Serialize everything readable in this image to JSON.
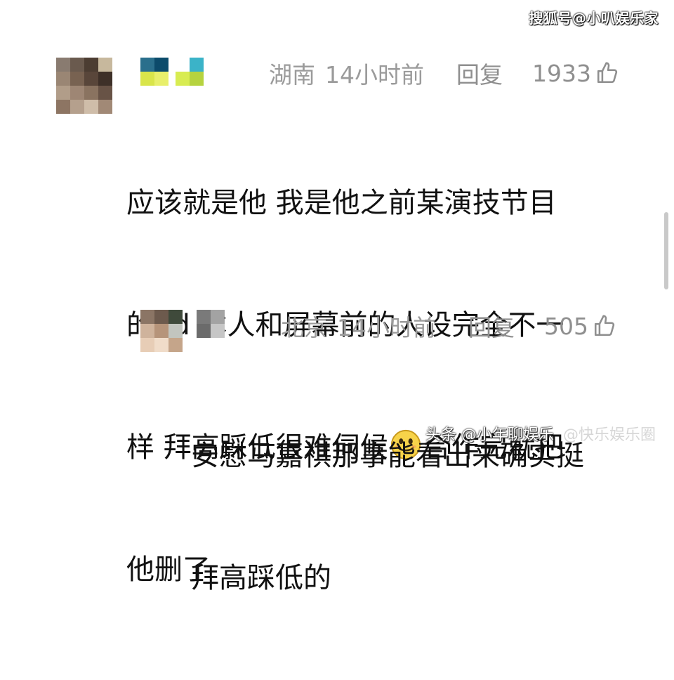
{
  "watermark_top": "搜狐号@小叭娱乐家",
  "comments": [
    {
      "location": "湖南",
      "time": "14小时前",
      "reply_label": "回复",
      "likes": "1933",
      "text_lines": [
        "应该就是他 我是他之前某演技节目",
        "的pd 本人和屏幕前的人设完全不一",
        "样 拜高踩低很难伺候",
        "他删了"
      ],
      "line3_after_emoji": "合作完就把"
    },
    {
      "location": "北京",
      "time": "14小时前",
      "reply_label": "回复",
      "likes": "505",
      "text_lines": [
        "安慰马嘉祺那事能看出来确实挺",
        "拜高踩低的"
      ]
    }
  ],
  "watermark_bottom": "头条 @小年聊娱乐",
  "watermark_bottom_ghost": "@快乐娱乐圈",
  "icons": {
    "thumb": "thumbs-up-icon",
    "emoji": "smile-emoji-icon"
  },
  "colors": {
    "meta": "#9b9b9b",
    "text": "#111111"
  }
}
